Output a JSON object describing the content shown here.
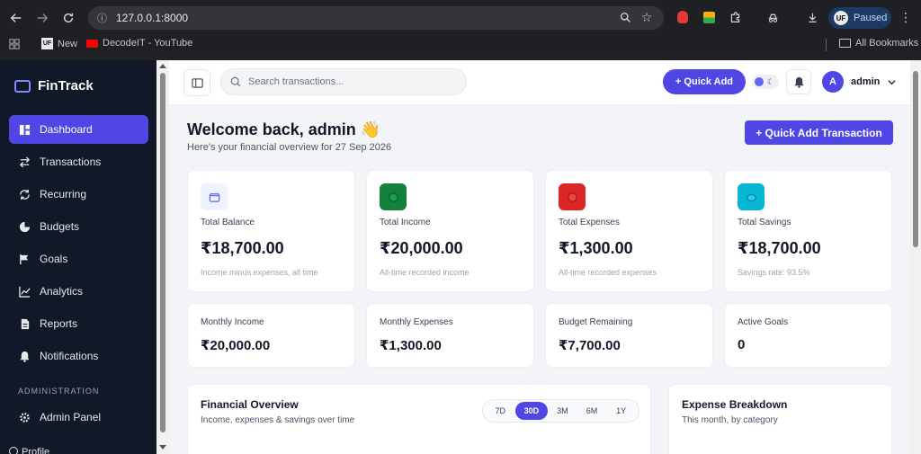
{
  "browser": {
    "url": "127.0.0.1:8000",
    "profile_status": "Paused",
    "profile_initials": "UF",
    "bookmarks": [
      {
        "label": "New",
        "icon": "uf-logo-icon"
      },
      {
        "label": "DecodeIT - YouTube",
        "icon": "youtube-icon"
      }
    ],
    "all_bookmarks": "All Bookmarks"
  },
  "sidebar": {
    "brand": "FinTrack",
    "items": [
      {
        "label": "Dashboard",
        "icon": "dashboard-icon",
        "active": true
      },
      {
        "label": "Transactions",
        "icon": "transactions-icon"
      },
      {
        "label": "Recurring",
        "icon": "recurring-icon"
      },
      {
        "label": "Budgets",
        "icon": "budgets-icon"
      },
      {
        "label": "Goals",
        "icon": "goals-flag-icon"
      },
      {
        "label": "Analytics",
        "icon": "analytics-icon"
      },
      {
        "label": "Reports",
        "icon": "reports-icon"
      },
      {
        "label": "Notifications",
        "icon": "bell-icon"
      }
    ],
    "section_admin": "ADMINISTRATION",
    "admin_item": {
      "label": "Admin Panel",
      "icon": "gear-icon"
    },
    "profile_partial": "Profile"
  },
  "topbar": {
    "search_placeholder": "Search transactions...",
    "quick_add": "+ Quick Add",
    "user_initial": "A",
    "user_name": "admin"
  },
  "header": {
    "welcome": "Welcome back, admin 👋",
    "subtitle": "Here's your financial overview for 27 Sep 2026",
    "quick_add_transaction": "+ Quick Add Transaction"
  },
  "stats": [
    {
      "label": "Total Balance",
      "value": "₹18,700.00",
      "note": "Income minus expenses, all time",
      "icon": "wallet-icon",
      "color": "#eef2ff"
    },
    {
      "label": "Total Income",
      "value": "₹20,000.00",
      "note": "All-time recorded income",
      "icon": "income-icon",
      "color": "#15803d"
    },
    {
      "label": "Total Expenses",
      "value": "₹1,300.00",
      "note": "All-time recorded expenses",
      "icon": "expense-icon",
      "color": "#dc2626"
    },
    {
      "label": "Total Savings",
      "value": "₹18,700.00",
      "note": "Savings rate: 93.5%",
      "icon": "piggy-bank-icon",
      "color": "#06b6d4"
    }
  ],
  "mini_stats": [
    {
      "label": "Monthly Income",
      "value": "₹20,000.00"
    },
    {
      "label": "Monthly Expenses",
      "value": "₹1,300.00"
    },
    {
      "label": "Budget Remaining",
      "value": "₹7,700.00"
    },
    {
      "label": "Active Goals",
      "value": "0"
    }
  ],
  "overview": {
    "title": "Financial Overview",
    "subtitle": "Income, expenses & savings over time",
    "ranges": [
      "7D",
      "30D",
      "3M",
      "6M",
      "1Y"
    ],
    "selected_range": "30D"
  },
  "breakdown": {
    "title": "Expense Breakdown",
    "subtitle": "This month, by category"
  }
}
